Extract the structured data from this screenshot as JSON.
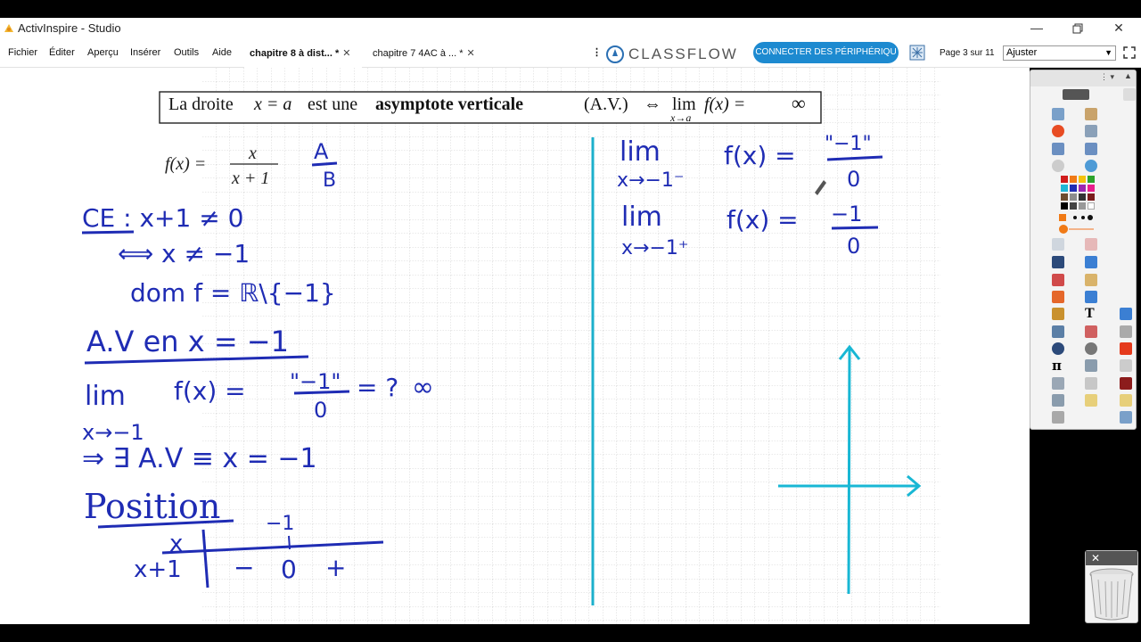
{
  "window": {
    "title": "ActivInspire - Studio"
  },
  "menu": [
    "Fichier",
    "Éditer",
    "Aperçu",
    "Insérer",
    "Outils",
    "Aide"
  ],
  "tabs": [
    {
      "label": "chapitre 8 à dist... *",
      "active": true
    },
    {
      "label": "chapitre 7 4AC à ... *",
      "active": false
    }
  ],
  "classflow": {
    "brand": "CLASSFLOW",
    "connect_label": "CONNECTER DES PÉRIPHÉRIQU"
  },
  "page": {
    "indicator": "Page 3 sur 11",
    "zoom": "Ajuster"
  },
  "board": {
    "box": {
      "text1": "La droite",
      "var1": "x = a",
      "text2": "est une",
      "bold": "asymptote verticale",
      "abbr": "(A.V.)",
      "iff": "⇔",
      "lim": "lim",
      "sub": "x→a",
      "rhs": "f(x) =",
      "inf": "∞"
    },
    "func": {
      "lhs": "f(x) =",
      "num": "x",
      "den": "x + 1"
    },
    "handwriting_left": {
      "ab_top": "A",
      "ab_bot": "B",
      "ce1": "CE : x+1 ≠ 0",
      "ce2": "⟺ x ≠ −1",
      "dom": "dom f = ℝ\\{−1}",
      "av": "A.V en x = −1",
      "lim": "lim",
      "fx": "f(x) =",
      "num": "\"−1\"",
      "den": "0",
      "eq": "= ?",
      "inf": "∞",
      "sub": "x→−1",
      "exists": "⇒ ∃ A.V ≡ x = −1",
      "position": "Position",
      "tbl_top": "−1",
      "tbl_x": "x",
      "tbl_row": "x+1",
      "tbl_minus": "−",
      "tbl_zero": "0",
      "tbl_plus": "+"
    },
    "handwriting_right": {
      "lim1": "lim",
      "sub1": "x→−1⁻",
      "fx1": "f(x) =",
      "num1": "\"−1\"",
      "den1": "0",
      "lim2": "lim",
      "sub2": "x→−1⁺",
      "fx2": "f(x) =",
      "num2": "−1",
      "den2": "0"
    }
  },
  "colors": {
    "ink": "#1f2cb4",
    "axis": "#18b7d4",
    "divider": "#1cb0cc",
    "grid": "#d9d9d9",
    "accent": "#1d8ad0"
  },
  "icons": [
    "app-icon",
    "minimize-icon",
    "restore-icon",
    "close-icon",
    "classflow-logo-icon",
    "grid-settings-icon",
    "trash-bin-icon"
  ]
}
